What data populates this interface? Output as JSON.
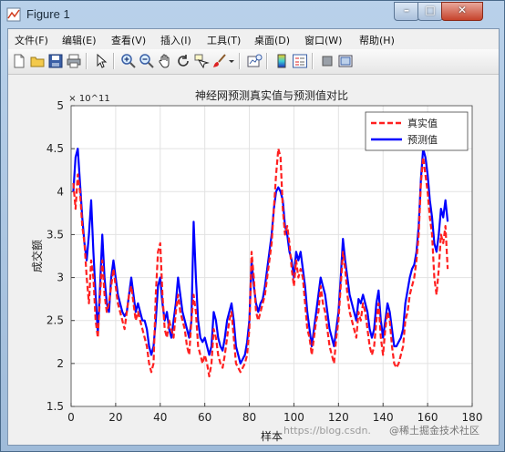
{
  "window": {
    "title": "Figure 1"
  },
  "title_buttons": {
    "minimize": "–",
    "maximize": "□",
    "close": "✕"
  },
  "menu": {
    "items": [
      {
        "label": "文件(F)",
        "name": "menu-file"
      },
      {
        "label": "编辑(E)",
        "name": "menu-edit"
      },
      {
        "label": "查看(V)",
        "name": "menu-view"
      },
      {
        "label": "插入(I)",
        "name": "menu-insert"
      },
      {
        "label": "工具(T)",
        "name": "menu-tools"
      },
      {
        "label": "桌面(D)",
        "name": "menu-desktop"
      },
      {
        "label": "窗口(W)",
        "name": "menu-window"
      },
      {
        "label": "帮助(H)",
        "name": "menu-help"
      }
    ]
  },
  "toolbar": {
    "icons": [
      "new-figure-icon",
      "open-file-icon",
      "save-icon",
      "print-icon",
      "pointer-icon",
      "zoom-in-icon",
      "zoom-out-icon",
      "pan-icon",
      "rotate-3d-icon",
      "data-cursor-icon",
      "brush-icon",
      "link-plot-icon",
      "colorbar-icon",
      "legend-icon",
      "hide-plot-tools-icon",
      "show-plot-tools-icon"
    ]
  },
  "watermark": {
    "url": "https://blog.csdn.",
    "brand": "@稀土掘金技术社区"
  },
  "chart_data": {
    "type": "line",
    "title": "神经网预测真实值与预测值对比",
    "xlabel": "样本",
    "ylabel": "成交额",
    "y_exponent": "× 10^11",
    "xlim": [
      0,
      180
    ],
    "ylim": [
      1.5,
      5
    ],
    "xticks": [
      0,
      20,
      40,
      60,
      80,
      100,
      120,
      140,
      160,
      180
    ],
    "yticks": [
      1.5,
      2,
      2.5,
      3,
      3.5,
      4,
      4.5,
      5
    ],
    "grid": true,
    "legend_position": "top-right",
    "series": [
      {
        "name": "真实值",
        "color": "#ff2020",
        "style": "dashed",
        "values": [
          4.1,
          3.8,
          4.2,
          4.0,
          3.6,
          3.4,
          3.0,
          2.7,
          3.2,
          3.0,
          2.5,
          2.3,
          2.8,
          3.2,
          2.8,
          2.6,
          2.7,
          2.9,
          3.1,
          2.9,
          2.7,
          2.6,
          2.5,
          2.4,
          2.6,
          2.8,
          2.9,
          2.7,
          2.5,
          2.6,
          2.5,
          2.4,
          2.3,
          2.2,
          2.0,
          1.9,
          2.0,
          2.8,
          3.3,
          3.4,
          2.8,
          2.4,
          2.3,
          2.5,
          2.4,
          2.3,
          2.6,
          2.8,
          2.6,
          2.5,
          2.4,
          2.2,
          2.1,
          2.5,
          2.8,
          2.6,
          2.2,
          2.1,
          2.0,
          2.1,
          2.0,
          1.85,
          2.0,
          2.4,
          2.3,
          2.1,
          2.0,
          1.95,
          2.1,
          2.3,
          2.5,
          2.6,
          2.3,
          2.0,
          1.95,
          1.9,
          1.95,
          2.0,
          2.1,
          2.4,
          3.3,
          3.0,
          2.6,
          2.5,
          2.6,
          2.7,
          2.8,
          3.0,
          3.2,
          3.4,
          3.8,
          4.2,
          4.5,
          4.4,
          3.8,
          3.5,
          3.6,
          3.4,
          3.1,
          2.9,
          3.2,
          3.0,
          3.1,
          3.0,
          2.7,
          2.4,
          2.3,
          2.1,
          2.3,
          2.5,
          2.6,
          2.9,
          2.7,
          2.6,
          2.4,
          2.2,
          2.1,
          2.0,
          2.3,
          2.5,
          2.9,
          3.3,
          3.1,
          2.8,
          2.6,
          2.5,
          2.4,
          2.3,
          2.6,
          2.5,
          2.7,
          2.6,
          2.4,
          2.2,
          2.1,
          2.2,
          2.5,
          2.7,
          2.3,
          2.1,
          2.4,
          2.6,
          2.5,
          2.2,
          2.0,
          1.95,
          2.0,
          2.1,
          2.2,
          2.5,
          2.6,
          2.8,
          2.9,
          3.0,
          3.2,
          3.5,
          4.1,
          4.4,
          4.2,
          4.0,
          3.7,
          3.5,
          3.0,
          2.8,
          3.1,
          3.5,
          3.4,
          3.6,
          3.1
        ]
      },
      {
        "name": "预测值",
        "color": "#0000ff",
        "style": "solid",
        "values": [
          4.0,
          4.4,
          4.5,
          4.1,
          3.7,
          3.4,
          3.2,
          3.5,
          3.9,
          3.3,
          2.8,
          2.35,
          2.9,
          3.5,
          3.0,
          2.7,
          2.6,
          3.0,
          3.2,
          3.0,
          2.8,
          2.7,
          2.6,
          2.55,
          2.6,
          2.8,
          3.0,
          2.8,
          2.6,
          2.7,
          2.6,
          2.5,
          2.5,
          2.4,
          2.2,
          2.1,
          2.2,
          2.5,
          2.9,
          3.0,
          2.7,
          2.5,
          2.6,
          2.4,
          2.3,
          2.5,
          2.7,
          3.0,
          2.8,
          2.6,
          2.5,
          2.4,
          2.3,
          2.5,
          3.65,
          3.0,
          2.5,
          2.3,
          2.25,
          2.3,
          2.2,
          2.1,
          2.2,
          2.6,
          2.5,
          2.3,
          2.2,
          2.15,
          2.3,
          2.5,
          2.6,
          2.7,
          2.5,
          2.2,
          2.1,
          2.0,
          2.05,
          2.1,
          2.25,
          2.5,
          3.2,
          2.9,
          2.7,
          2.6,
          2.7,
          2.75,
          2.9,
          3.1,
          3.3,
          3.5,
          3.8,
          4.0,
          4.05,
          4.0,
          3.9,
          3.6,
          3.5,
          3.3,
          3.2,
          3.0,
          3.3,
          3.2,
          3.3,
          3.1,
          2.9,
          2.6,
          2.4,
          2.2,
          2.4,
          2.6,
          2.8,
          3.0,
          2.9,
          2.8,
          2.6,
          2.4,
          2.3,
          2.2,
          2.4,
          2.6,
          3.0,
          3.45,
          3.2,
          3.0,
          2.8,
          2.7,
          2.6,
          2.5,
          2.75,
          2.7,
          2.8,
          2.7,
          2.6,
          2.4,
          2.3,
          2.4,
          2.7,
          2.85,
          2.5,
          2.3,
          2.5,
          2.7,
          2.6,
          2.4,
          2.2,
          2.2,
          2.25,
          2.3,
          2.4,
          2.7,
          2.85,
          3.0,
          3.1,
          3.15,
          3.3,
          3.6,
          4.15,
          4.5,
          4.4,
          4.2,
          3.9,
          3.7,
          3.4,
          3.3,
          3.5,
          3.8,
          3.7,
          3.9,
          3.65
        ]
      }
    ]
  }
}
